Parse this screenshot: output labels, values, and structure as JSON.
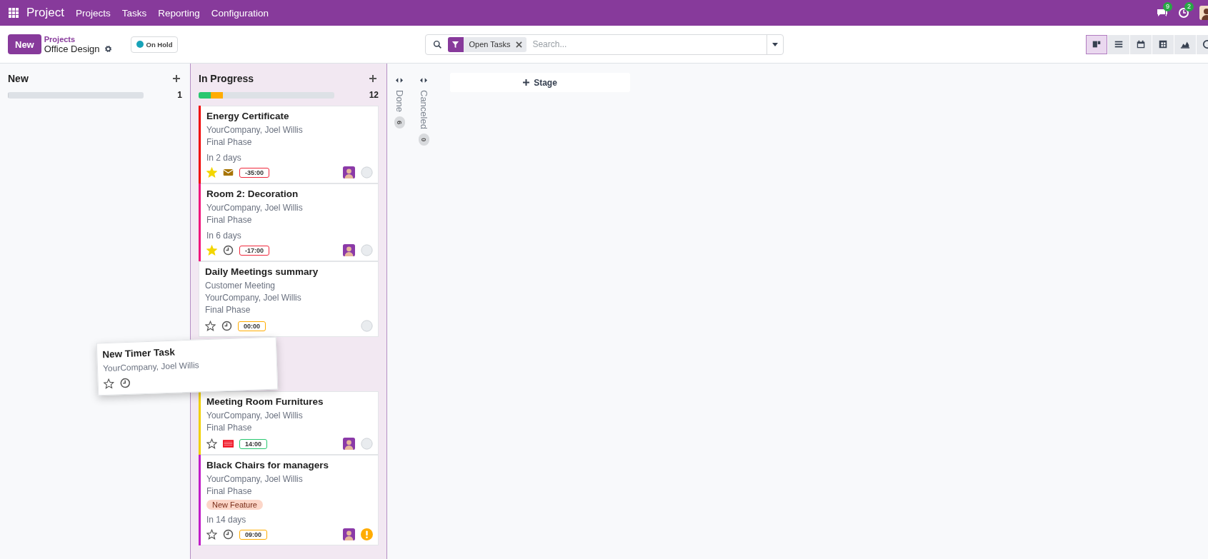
{
  "topbar": {
    "app_name": "Project",
    "menu": [
      "Projects",
      "Tasks",
      "Reporting",
      "Configuration"
    ],
    "notifications": [
      {
        "kind": "chat",
        "count": "9"
      },
      {
        "kind": "activity",
        "count": "2"
      }
    ]
  },
  "control": {
    "new_button": "New",
    "breadcrumb": "Projects",
    "title": "Office Design",
    "status": {
      "label": "On Hold",
      "color": "#17a2b8"
    }
  },
  "search": {
    "facet": "Open Tasks",
    "placeholder": "Search..."
  },
  "views": [
    {
      "kind": "kanban",
      "selected": true
    },
    {
      "kind": "list",
      "selected": false
    },
    {
      "kind": "calendar",
      "selected": false
    },
    {
      "kind": "pivot",
      "selected": false
    },
    {
      "kind": "graph",
      "selected": false
    },
    {
      "kind": "activity",
      "selected": false
    }
  ],
  "columns": [
    {
      "kind": "open",
      "title": "New",
      "count": "1",
      "progress": [
        {
          "level": 0
        }
      ]
    },
    {
      "kind": "open",
      "title": "In Progress",
      "count": "12",
      "progress": [
        {
          "color": "#28c76f",
          "level": 0.09
        },
        {
          "color": "#ffac00",
          "level": 0.09
        }
      ],
      "cards": [
        {
          "kind": "task",
          "title": "Energy Certificate",
          "lines": [
            "YourCompany, Joel Willis",
            "Final Phase"
          ],
          "deadline": "In 2 days",
          "starred": true,
          "activity": {
            "kind": "mail"
          },
          "timer": {
            "text": "-35:00",
            "color": "#f0283c"
          },
          "color": "#f00000",
          "avatar": true,
          "blocked": false
        },
        {
          "kind": "task",
          "title": "Room 2: Decoration",
          "lines": [
            "YourCompany, Joel Willis",
            "Final Phase"
          ],
          "deadline": "In 6 days",
          "starred": true,
          "activity": {
            "kind": "clock"
          },
          "timer": {
            "text": "-17:00",
            "color": "#f0283c"
          },
          "color": "#f0147c",
          "avatar": true,
          "blocked": false
        },
        {
          "kind": "task",
          "title": "Daily Meetings summary",
          "lines": [
            "Customer Meeting",
            "YourCompany, Joel Willis",
            "Final Phase"
          ],
          "starred": false,
          "activity": {
            "kind": "clock"
          },
          "timer": {
            "text": "00:00",
            "color": "#ffac00"
          },
          "blocked": false
        },
        {
          "kind": "dragged",
          "title": "New Timer Task",
          "lines": [
            "YourCompany, Joel Willis"
          ],
          "starred": false,
          "activity": {
            "kind": "clock"
          }
        },
        {
          "kind": "task",
          "title": "Meeting Room Furnitures",
          "lines": [
            "YourCompany, Joel Willis",
            "Final Phase"
          ],
          "starred": false,
          "activity": {
            "kind": "list"
          },
          "timer": {
            "text": "14:00",
            "color": "#28c76f"
          },
          "color": "#f0d000",
          "avatar": true,
          "blocked": false
        },
        {
          "kind": "task",
          "title": "Black Chairs for managers",
          "lines": [
            "YourCompany, Joel Willis",
            "Final Phase"
          ],
          "tag": "New Feature",
          "deadline": "In 14 days",
          "starred": false,
          "activity": {
            "kind": "clock"
          },
          "timer": {
            "text": "09:00",
            "color": "#ffac00"
          },
          "color": "#c01cc8",
          "avatar": true,
          "blocked": true
        }
      ]
    },
    {
      "kind": "folded",
      "title": "Done",
      "count": "6"
    },
    {
      "kind": "folded",
      "title": "Canceled",
      "count": "0"
    }
  ],
  "stage_button": "Stage"
}
